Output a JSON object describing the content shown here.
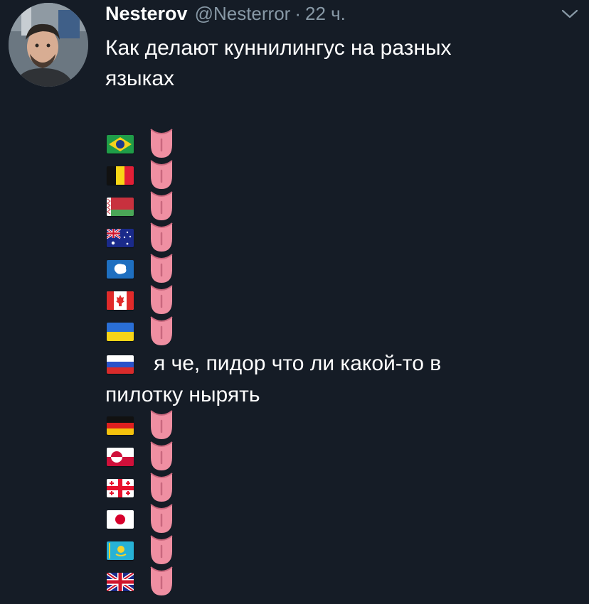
{
  "tweet": {
    "name": "Nesterov",
    "handle": "@Nesterror",
    "separator": "·",
    "time": "22 ч.",
    "text_line1": "Как делают куннилингус на разных",
    "text_line2": "языках",
    "russia_line1": "я че, пидор что ли какой-то в",
    "russia_line2": "пилотку нырять"
  },
  "icons": {
    "avatar": "user-avatar",
    "menu": "chevron-down-icon",
    "tongue": "tongue-emoji"
  },
  "flags": [
    "brazil",
    "belgium",
    "belarus",
    "australia",
    "antarctica",
    "canada",
    "ukraine",
    "russia",
    "germany",
    "greenland",
    "georgia",
    "japan",
    "kazakhstan",
    "united-kingdom"
  ],
  "colors": {
    "background": "#151c26",
    "text": "#ffffff",
    "muted": "#8899a6",
    "tongue": "#ef8fa2"
  }
}
